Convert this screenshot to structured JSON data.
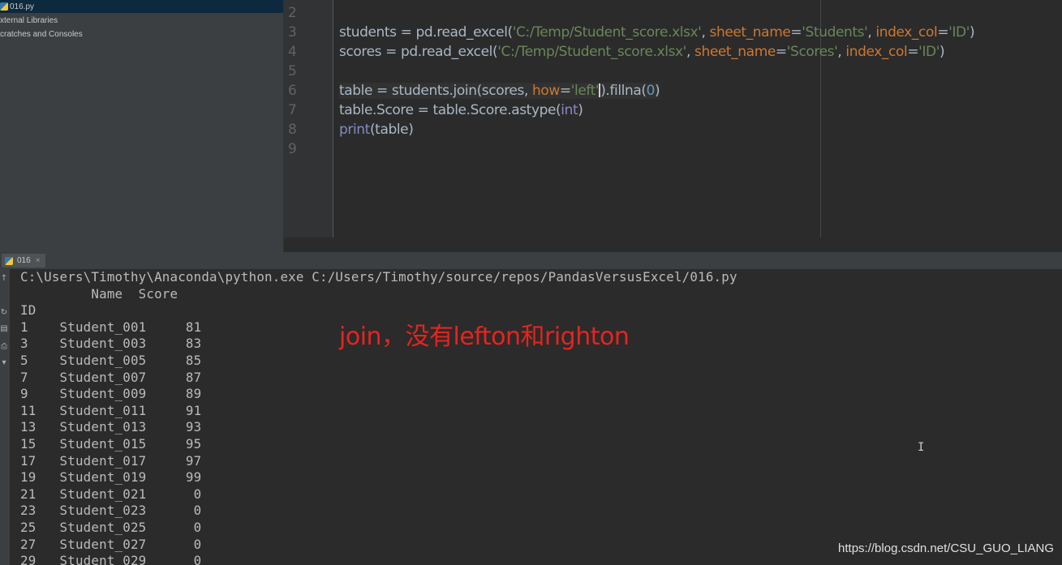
{
  "project_panel": {
    "items": [
      {
        "label": "016.py",
        "icon": "python-file-icon",
        "selected": true
      },
      {
        "label": "xternal Libraries"
      },
      {
        "label": "cratches and Consoles"
      }
    ]
  },
  "editor": {
    "line_numbers": [
      "2",
      "3",
      "4",
      "5",
      "6",
      "7",
      "8",
      "9"
    ],
    "lines": {
      "l3": {
        "a": "students = pd.read_excel(",
        "s1": "'C:/Temp/Student_score.xlsx'",
        "c1": ", ",
        "k1": "sheet_name",
        "e1": "=",
        "s2": "'Students'",
        "c2": ", ",
        "k2": "index_col",
        "e2": "=",
        "s3": "'ID'",
        "z": ")"
      },
      "l4": {
        "a": "scores = pd.read_excel(",
        "s1": "'C:/Temp/Student_score.xlsx'",
        "c1": ", ",
        "k1": "sheet_name",
        "e1": "=",
        "s2": "'Scores'",
        "c2": ", ",
        "k2": "index_col",
        "e2": "=",
        "s3": "'ID'",
        "z": ")"
      },
      "l6": {
        "a": "table = students.join(scores, ",
        "k1": "how",
        "e1": "=",
        "s1": "'left'",
        "b": ").fillna(",
        "n1": "0",
        "z": ")"
      },
      "l7": {
        "a": "table.Score = table.Score.astype(",
        "b1": "int",
        "z": ")"
      },
      "l8": {
        "b1": "print",
        "z": "(table)"
      }
    }
  },
  "run_panel": {
    "tab_label": "016",
    "tab_close": "×",
    "side_icons": [
      "up-arrow-icon",
      "rerun-icon",
      "stop-icon",
      "print-icon",
      "trash-icon"
    ]
  },
  "console": {
    "command": "C:\\Users\\Timothy\\Anaconda\\python.exe C:/Users/Timothy/source/repos/PandasVersusExcel/016.py",
    "header": "         Name  Score",
    "index_label": "ID",
    "rows": [
      "1    Student_001     81",
      "3    Student_003     83",
      "5    Student_005     85",
      "7    Student_007     87",
      "9    Student_009     89",
      "11   Student_011     91",
      "13   Student_013     93",
      "15   Student_015     95",
      "17   Student_017     97",
      "19   Student_019     99",
      "21   Student_021      0",
      "23   Student_023      0",
      "25   Student_025      0",
      "27   Student_027      0",
      "29   Student_029      0"
    ]
  },
  "annotation": "join，没有lefton和righton",
  "watermark": "https://blog.csdn.net/CSU_GUO_LIANG",
  "colors": {
    "background": "#2b2b2b",
    "panel": "#3c3f41",
    "string": "#6a8759",
    "keyword": "#cc7832",
    "number": "#6897bb",
    "builtin": "#8888c6",
    "annotation": "#e8231d"
  }
}
